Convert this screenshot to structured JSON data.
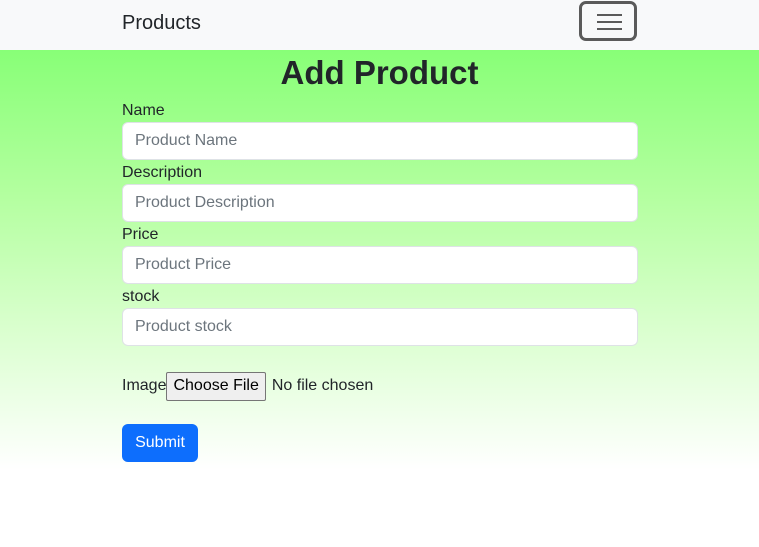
{
  "navbar": {
    "brand": "Products",
    "toggler_icon": "hamburger-menu-icon"
  },
  "page": {
    "title": "Add Product"
  },
  "form": {
    "name_label": "Name",
    "name_placeholder": "Product Name",
    "description_label": "Description",
    "description_placeholder": "Product Description",
    "price_label": "Price",
    "price_placeholder": "Product Price",
    "stock_label": "stock",
    "stock_placeholder": "Product stock",
    "image_label": "Image",
    "choose_file_label": "Choose File",
    "file_status": "No file chosen",
    "submit_label": "Submit"
  },
  "colors": {
    "primary": "#0d6efd",
    "gradient_top": "#88ff77",
    "gradient_bottom": "#ffffff",
    "navbar_bg": "#f8f9fa"
  }
}
